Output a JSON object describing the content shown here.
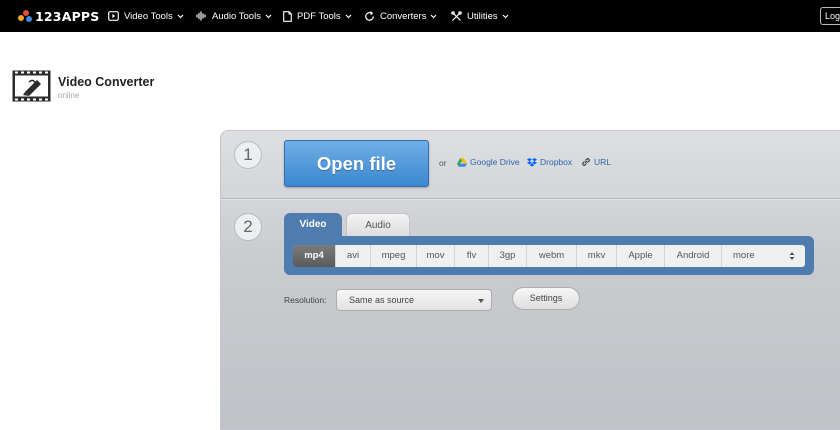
{
  "topbar": {
    "logo_text": "123APPS",
    "nav": [
      {
        "label": "Video Tools",
        "icon": "video-tools-icon"
      },
      {
        "label": "Audio Tools",
        "icon": "audio-tools-icon"
      },
      {
        "label": "PDF Tools",
        "icon": "pdf-tools-icon"
      },
      {
        "label": "Converters",
        "icon": "converters-icon"
      },
      {
        "label": "Utilities",
        "icon": "utilities-icon"
      }
    ],
    "login_label": "Log"
  },
  "header": {
    "title": "Video Converter",
    "subtitle": "online"
  },
  "step1": {
    "number": "1",
    "open_button": "Open file",
    "or_text": "or",
    "sources": [
      {
        "label": "Google Drive",
        "icon": "google-drive-icon"
      },
      {
        "label": "Dropbox",
        "icon": "dropbox-icon"
      },
      {
        "label": "URL",
        "icon": "link-icon"
      }
    ]
  },
  "step2": {
    "number": "2",
    "tabs": [
      "Video",
      "Audio"
    ],
    "active_tab": "Video",
    "formats": [
      "mp4",
      "avi",
      "mpeg",
      "mov",
      "flv",
      "3gp",
      "webm",
      "mkv",
      "Apple",
      "Android",
      "more"
    ],
    "selected_format": "mp4",
    "resolution_label": "Resolution:",
    "resolution_value": "Same as source",
    "settings_label": "Settings"
  },
  "colors": {
    "accent_blue": "#3b87cf",
    "tab_blue": "#4e7caf",
    "link_blue": "#2d67ad",
    "topbar": "#000000"
  }
}
